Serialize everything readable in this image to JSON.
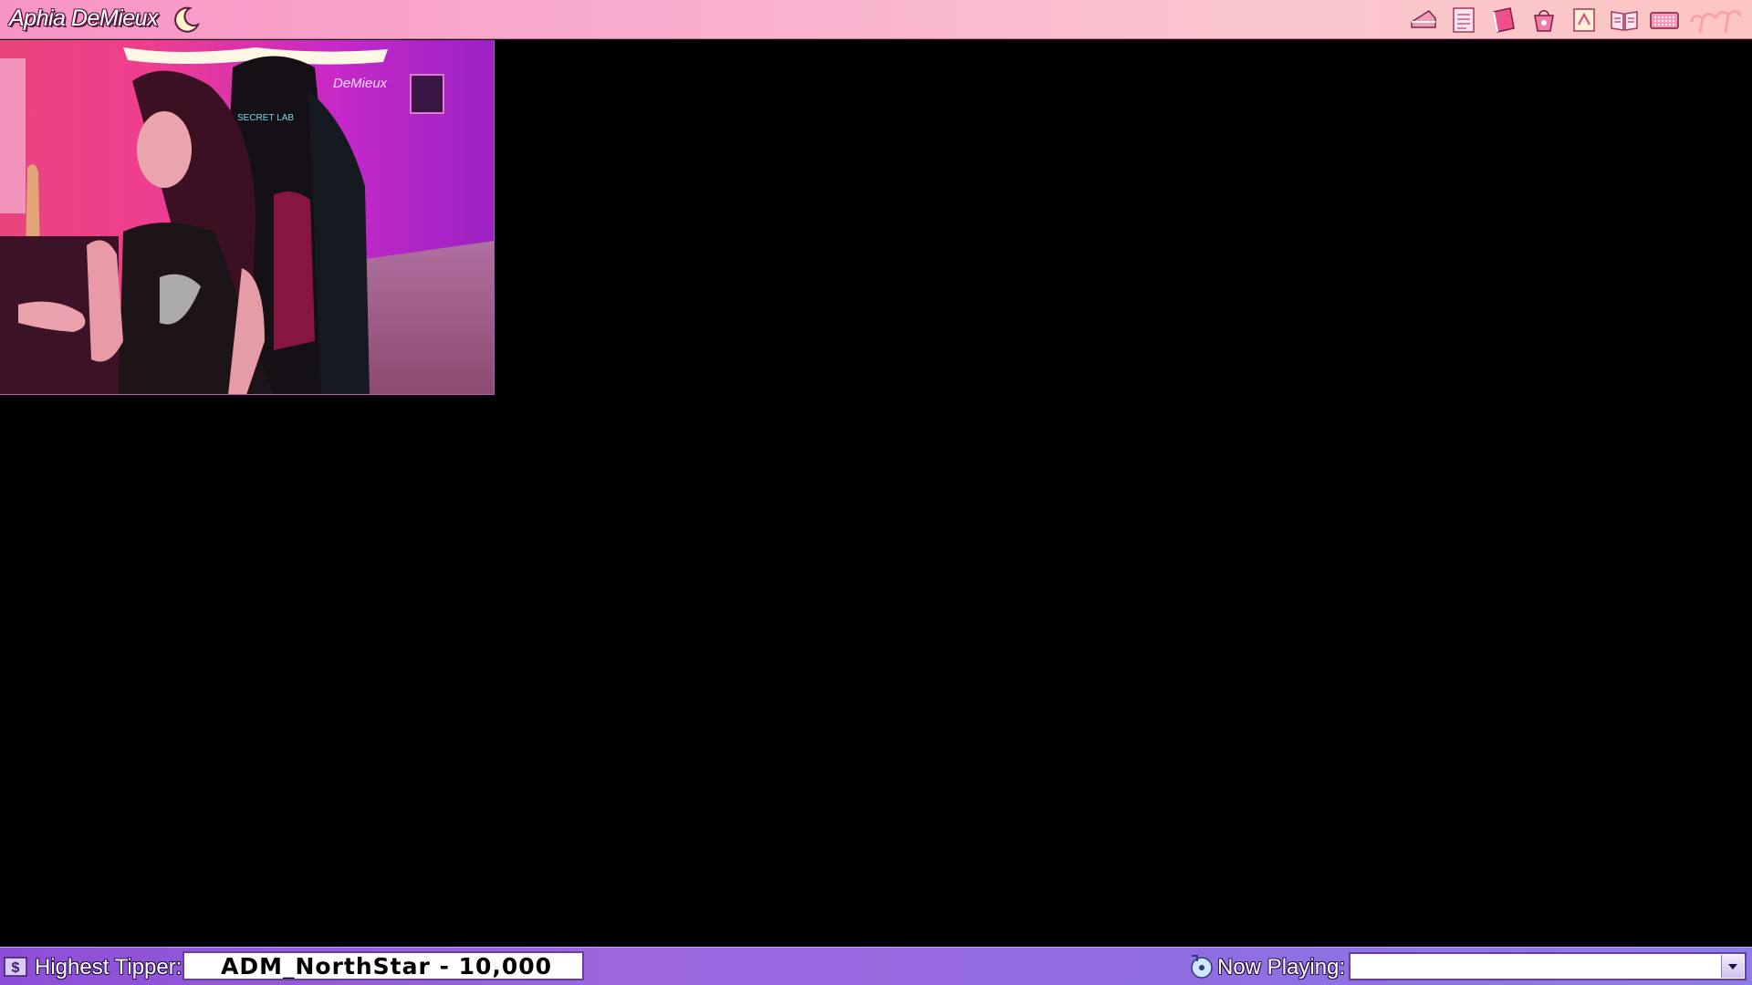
{
  "window": {
    "title": "Aphia DeMieux"
  },
  "icons": {
    "title": "crescent-moon-icon",
    "tray": [
      "cake-slice-icon",
      "notepad-icon",
      "pink-book-icon",
      "gift-bag-icon",
      "sticky-note-icon",
      "open-book-icon",
      "keyboard-icon",
      "palm-tree-icon"
    ],
    "tipper": "dollar-icon",
    "now_playing": "music-disc-icon",
    "dropdown": "chevron-down-icon"
  },
  "webcam": {
    "visible_text": [
      "SECRET LAB",
      "DeMieux"
    ]
  },
  "bottom_bar": {
    "tipper_label": "Highest Tipper:",
    "tipper_value": "ADM_NorthStar - 10,000",
    "now_playing_label": "Now Playing:",
    "now_playing_value": ""
  },
  "colors": {
    "titlebar": "#f794c6",
    "bottombar": "#9d66df",
    "background": "#000000"
  }
}
